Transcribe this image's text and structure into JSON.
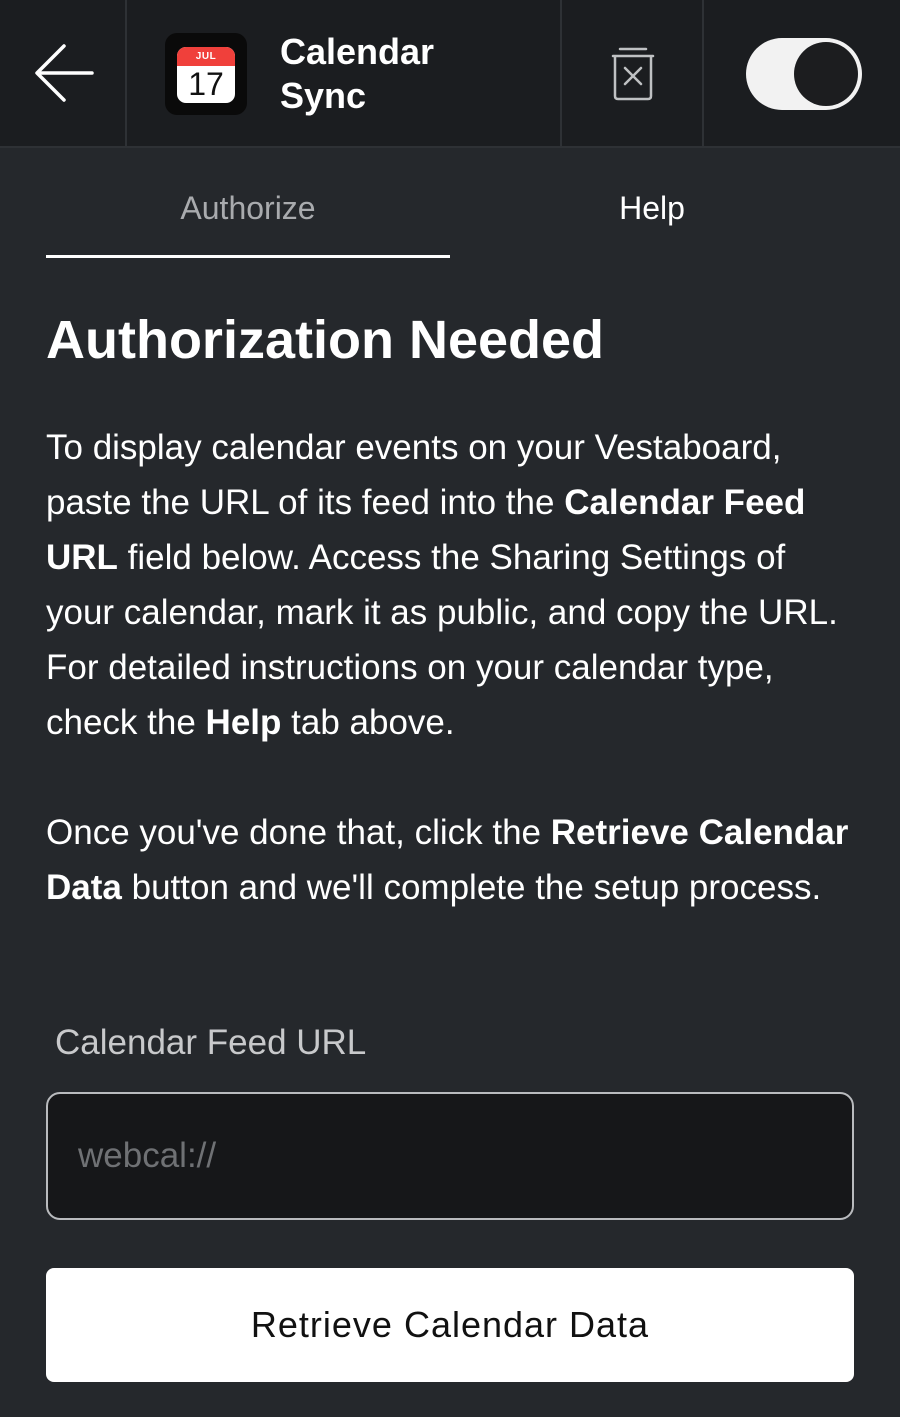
{
  "header": {
    "back_icon": "arrow-left-icon",
    "app_icon": {
      "name": "calendar-icon",
      "month": "JUL",
      "day": "17"
    },
    "app_title": "Calendar Sync",
    "delete_icon": "trash-icon",
    "toggle": {
      "state": "on"
    }
  },
  "tabs": [
    {
      "label": "Authorize",
      "active": true
    },
    {
      "label": "Help",
      "active": false
    }
  ],
  "content": {
    "title": "Authorization Needed",
    "para1": [
      {
        "text": "To display calendar events on your Vestaboard, paste the URL of its feed into the ",
        "bold": false
      },
      {
        "text": "Calendar Feed URL",
        "bold": true
      },
      {
        "text": " field below. Access the Sharing Settings of your calendar, mark it as public, and copy the URL. For detailed instructions on your calendar type, check the ",
        "bold": false
      },
      {
        "text": "Help",
        "bold": true
      },
      {
        "text": " tab above.",
        "bold": false
      }
    ],
    "para2": [
      {
        "text": "Once you've done that, click the ",
        "bold": false
      },
      {
        "text": "Retrieve Calendar Data",
        "bold": true
      },
      {
        "text": " button and we'll complete the setup process.",
        "bold": false
      }
    ]
  },
  "form": {
    "field_label": "Calendar Feed URL",
    "url_value": "",
    "url_placeholder": "webcal://",
    "submit_label": "Retrieve Calendar Data"
  },
  "colors": {
    "background": "#25282c",
    "header_background": "#1b1d20",
    "calendar_red": "#f0403b"
  }
}
